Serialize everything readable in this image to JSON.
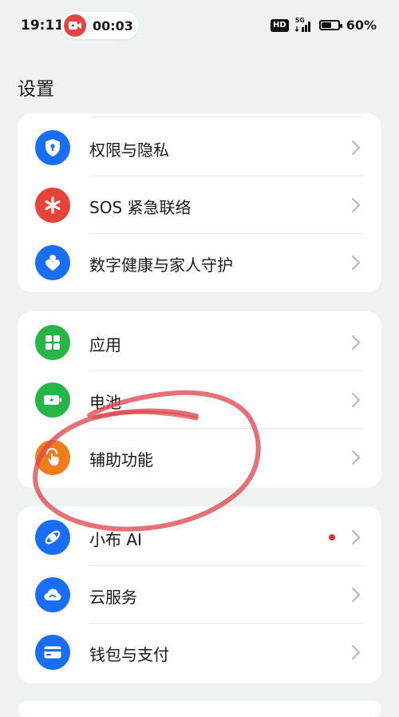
{
  "status_bar": {
    "time": "19:11",
    "recording_time": "00:03",
    "hd_label": "HD",
    "network_label": "5G",
    "battery_percent": "60%",
    "battery_level": 0.6
  },
  "page": {
    "title": "设置"
  },
  "groups": [
    {
      "items": [
        {
          "label": "权限与隐私",
          "icon": "shield-icon",
          "color": "#1a6ef5"
        },
        {
          "label": "SOS 紧急联络",
          "icon": "asterisk-icon",
          "color": "#e8423a"
        },
        {
          "label": "数字健康与家人守护",
          "icon": "family-care-icon",
          "color": "#1a6ef5"
        }
      ]
    },
    {
      "items": [
        {
          "label": "应用",
          "icon": "apps-grid-icon",
          "color": "#26b547"
        },
        {
          "label": "电池",
          "icon": "battery-charging-icon",
          "color": "#26b547"
        },
        {
          "label": "辅助功能",
          "icon": "touch-hand-icon",
          "color": "#f07c1a"
        }
      ]
    },
    {
      "items": [
        {
          "label": "小布 AI",
          "icon": "ai-assistant-icon",
          "color": "#1a6ef5",
          "badge_dot": true
        },
        {
          "label": "云服务",
          "icon": "cloud-icon",
          "color": "#1a6ef5"
        },
        {
          "label": "钱包与支付",
          "icon": "card-icon",
          "color": "#1a6ef5"
        }
      ]
    }
  ],
  "colors": {
    "background": "#eef2f1",
    "annotation": "#e0474f"
  }
}
